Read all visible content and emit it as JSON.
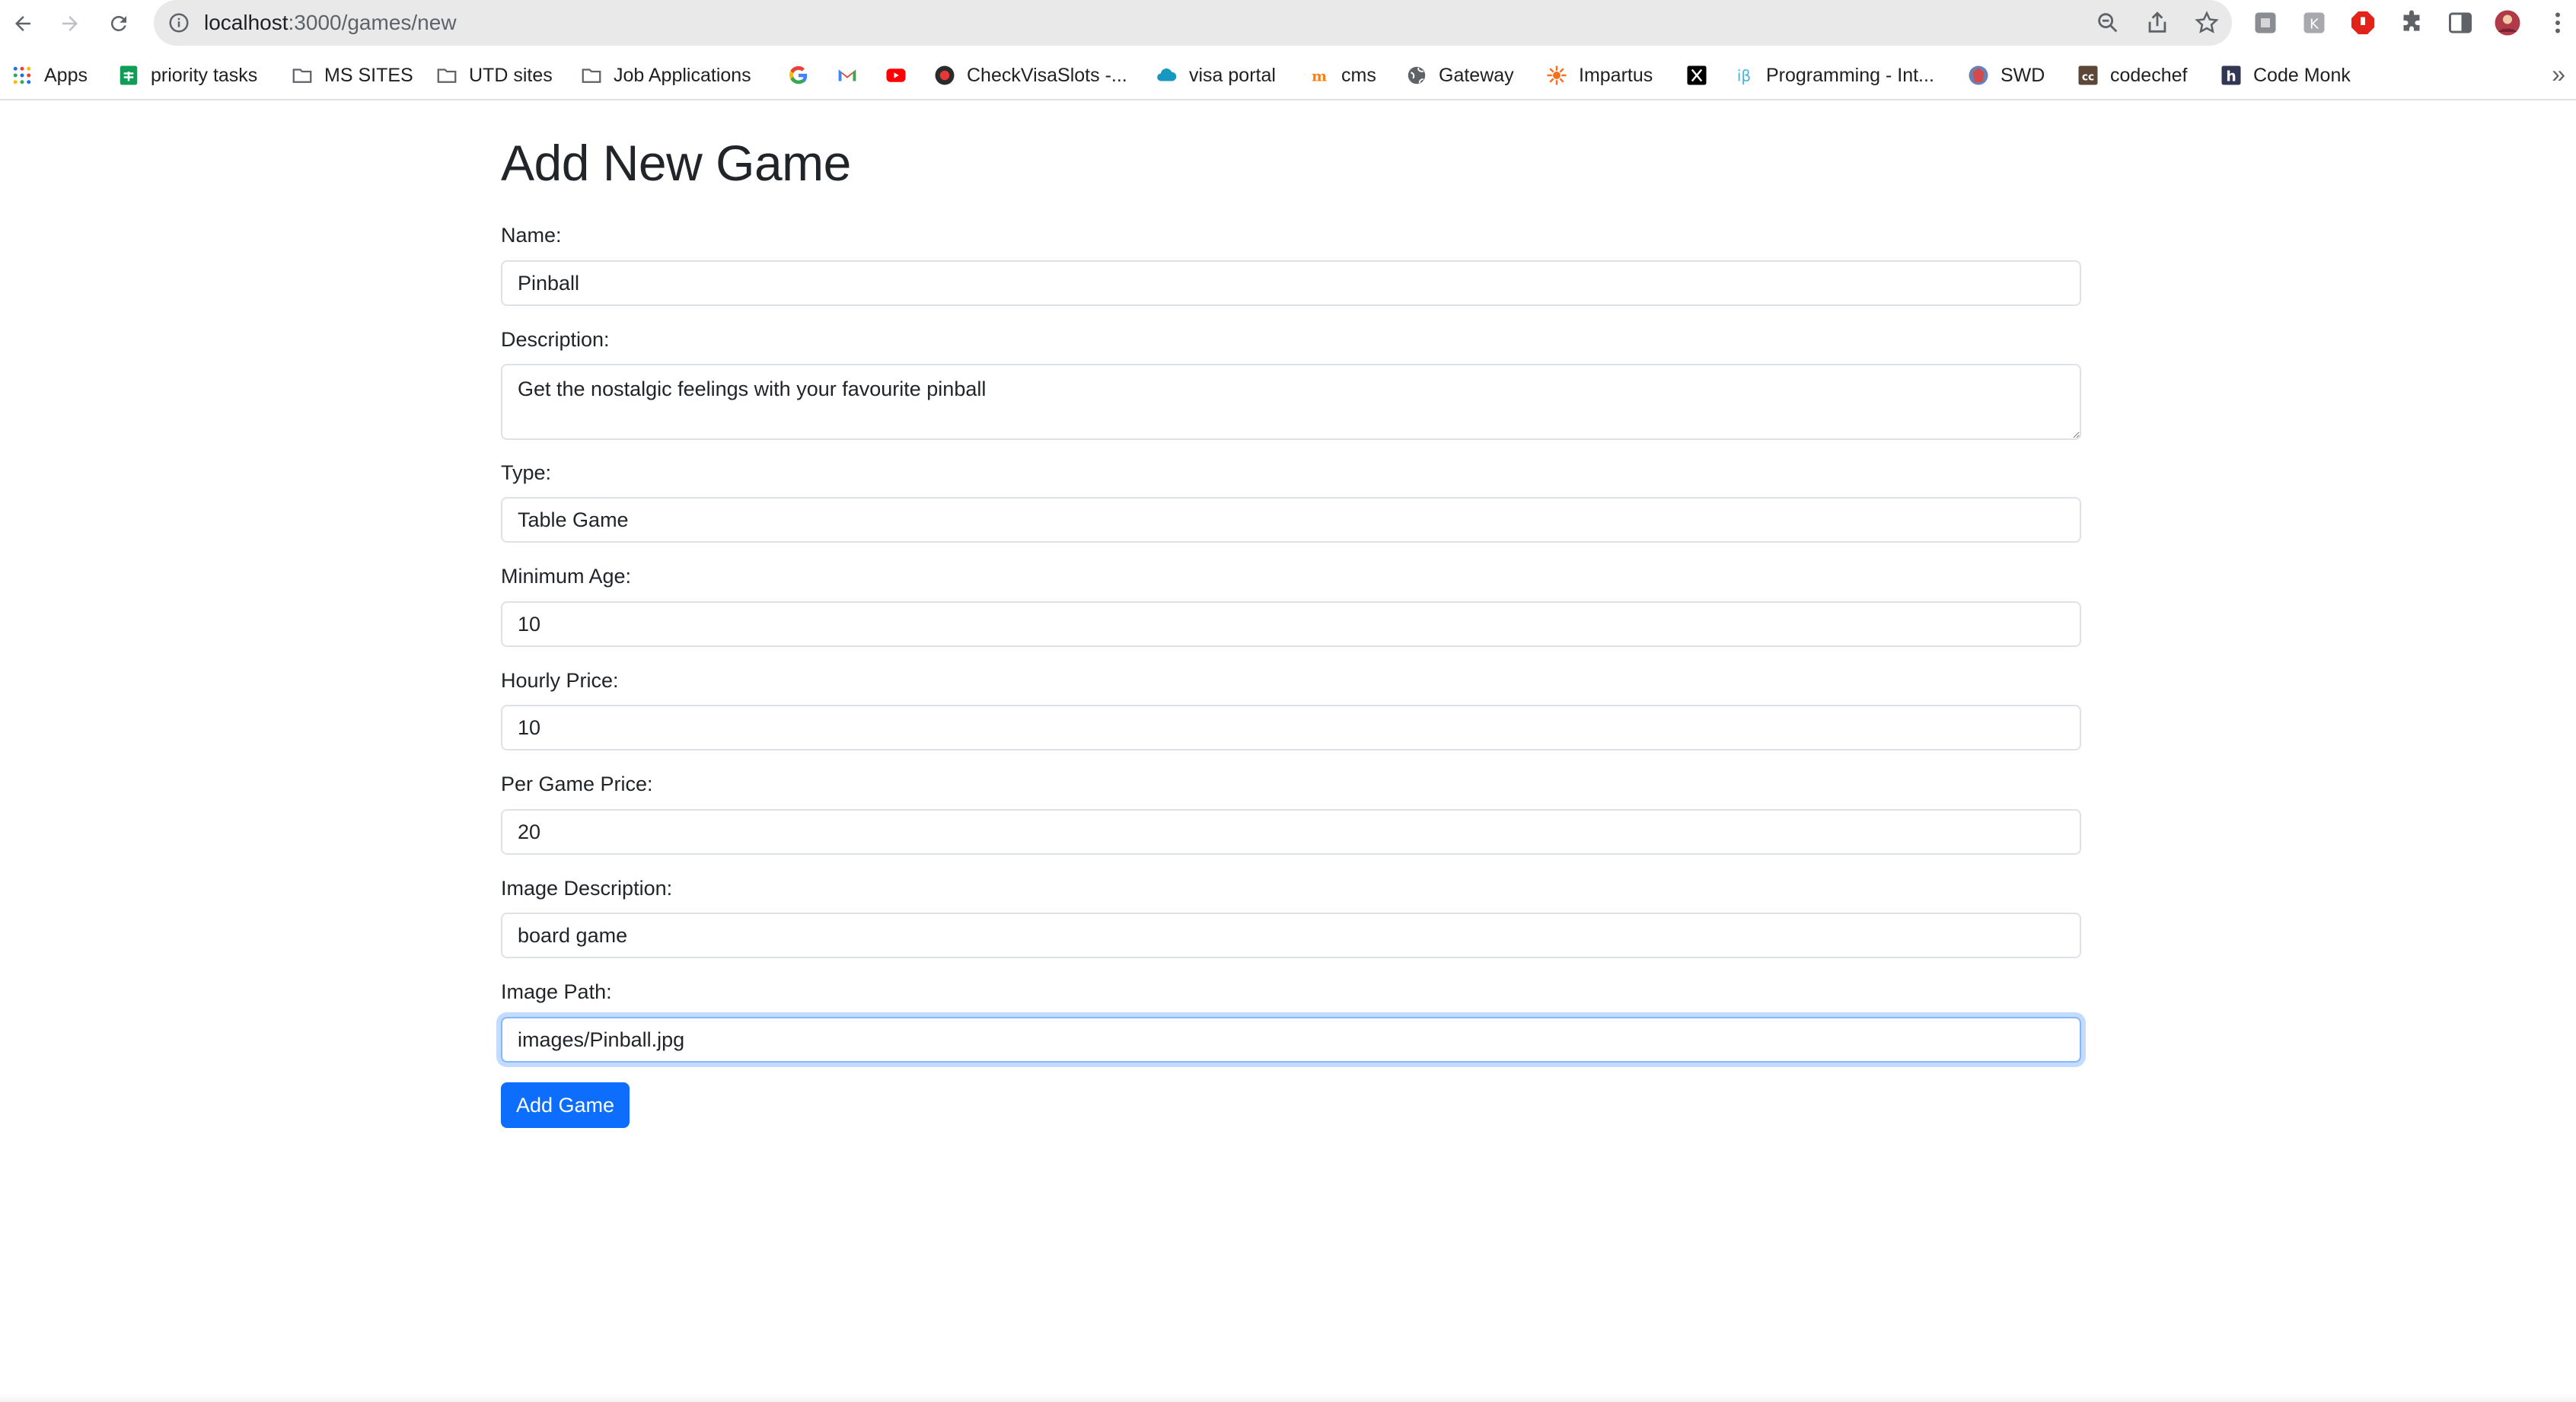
{
  "browser": {
    "url_host": "localhost",
    "url_path": ":3000/games/new",
    "bookmarks": [
      {
        "label": "Apps",
        "icon": "apps-grid-icon"
      },
      {
        "label": "priority tasks",
        "icon": "sheets-icon"
      },
      {
        "label": "MS SITES",
        "icon": "folder-icon"
      },
      {
        "label": "UTD sites",
        "icon": "folder-icon"
      },
      {
        "label": "Job Applications",
        "icon": "folder-icon"
      },
      {
        "label": "",
        "icon": "google-icon"
      },
      {
        "label": "",
        "icon": "gmail-icon"
      },
      {
        "label": "",
        "icon": "youtube-icon"
      },
      {
        "label": "CheckVisaSlots -...",
        "icon": "checkvisaslots-icon"
      },
      {
        "label": "visa portal",
        "icon": "cloud-icon"
      },
      {
        "label": "cms",
        "icon": "cms-icon"
      },
      {
        "label": "Gateway",
        "icon": "globe-icon"
      },
      {
        "label": "Impartus",
        "icon": "impartus-icon"
      },
      {
        "label": "",
        "icon": "x-icon"
      },
      {
        "label": "Programming - Int...",
        "icon": "interviewbit-icon"
      },
      {
        "label": "SWD",
        "icon": "swd-icon"
      },
      {
        "label": "codechef",
        "icon": "codechef-icon"
      },
      {
        "label": "Code Monk",
        "icon": "hackerearth-icon"
      }
    ],
    "more": "»"
  },
  "form": {
    "title": "Add New Game",
    "name_label": "Name:",
    "name_value": "Pinball",
    "description_label": "Description:",
    "description_value": "Get the nostalgic feelings with your favourite pinball",
    "type_label": "Type:",
    "type_value": "Table Game",
    "min_age_label": "Minimum Age:",
    "min_age_value": "10",
    "hourly_price_label": "Hourly Price:",
    "hourly_price_value": "10",
    "per_game_price_label": "Per Game Price:",
    "per_game_price_value": "20",
    "image_description_label": "Image Description:",
    "image_description_value": "board game",
    "image_path_label": "Image Path:",
    "image_path_value": "images/Pinball.jpg",
    "submit_label": "Add Game"
  },
  "colors": {
    "primary": "#0d6efd",
    "focus_ring": "#86b7fe",
    "omnibox": "#e9e9ea"
  }
}
